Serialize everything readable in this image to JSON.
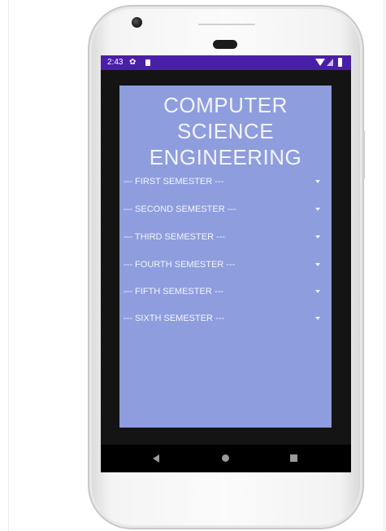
{
  "status_bar": {
    "time": "2:43",
    "icons": [
      "settings-icon",
      "sd-card-icon",
      "wifi-icon",
      "signal-icon",
      "battery-icon"
    ]
  },
  "app": {
    "title": "COMPUTER SCIENCE ENGINEERING",
    "background_color": "#8e9ddd",
    "status_bar_color": "#4a1fa8",
    "semesters": [
      {
        "label": "--- FIRST SEMESTER ---"
      },
      {
        "label": "--- SECOND SEMESTER ---"
      },
      {
        "label": "--- THIRD SEMESTER ---"
      },
      {
        "label": "--- FOURTH SEMESTER ---"
      },
      {
        "label": "--- FIFTH SEMESTER ---"
      },
      {
        "label": "--- SIXTH SEMESTER ---"
      }
    ]
  },
  "navigation_bar": {
    "buttons": [
      "back-icon",
      "home-icon",
      "recents-icon"
    ]
  }
}
